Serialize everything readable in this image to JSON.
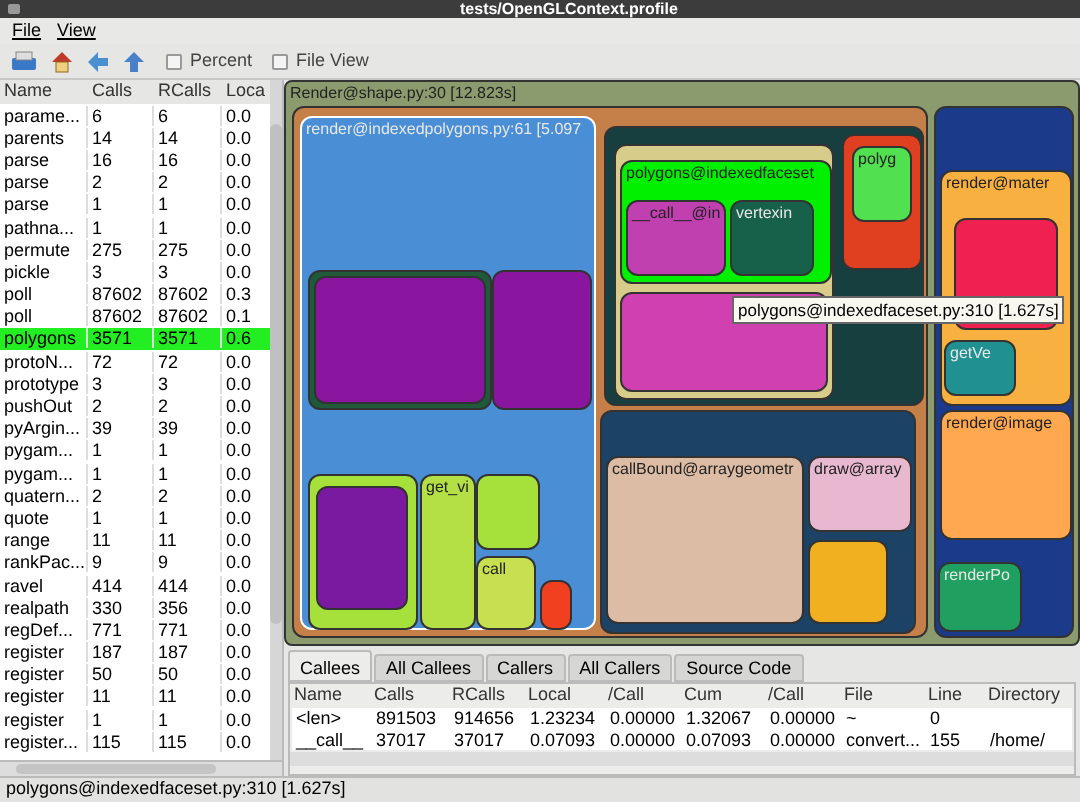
{
  "window": {
    "title": "tests/OpenGLContext.profile"
  },
  "menu": [
    "File",
    "View"
  ],
  "toolbar": {
    "checkboxes": [
      {
        "label": "Percent",
        "checked": false
      },
      {
        "label": "File View",
        "checked": false
      }
    ]
  },
  "function_list": {
    "columns": [
      "Name",
      "Calls",
      "RCalls",
      "Loca"
    ],
    "rows": [
      {
        "cells": [
          "parame...",
          "6",
          "6",
          "0.0"
        ],
        "selected": false
      },
      {
        "cells": [
          "parents",
          "14",
          "14",
          "0.0"
        ],
        "selected": false
      },
      {
        "cells": [
          "parse",
          "16",
          "16",
          "0.0"
        ],
        "selected": false
      },
      {
        "cells": [
          "parse",
          "2",
          "2",
          "0.0"
        ],
        "selected": false
      },
      {
        "cells": [
          "parse",
          "1",
          "1",
          "0.0"
        ],
        "selected": false
      },
      {
        "cells": [
          "pathna...",
          "1",
          "1",
          "0.0"
        ],
        "selected": false
      },
      {
        "cells": [
          "permute",
          "275",
          "275",
          "0.0"
        ],
        "selected": false
      },
      {
        "cells": [
          "pickle",
          "3",
          "3",
          "0.0"
        ],
        "selected": false
      },
      {
        "cells": [
          "poll",
          "87602",
          "87602",
          "0.3"
        ],
        "selected": false
      },
      {
        "cells": [
          "poll",
          "87602",
          "87602",
          "0.1"
        ],
        "selected": false
      },
      {
        "cells": [
          "polygons",
          "3571",
          "3571",
          "0.6"
        ],
        "selected": true
      },
      {
        "cells": [
          "protoN...",
          "72",
          "72",
          "0.0"
        ],
        "selected": false
      },
      {
        "cells": [
          "prototype",
          "3",
          "3",
          "0.0"
        ],
        "selected": false
      },
      {
        "cells": [
          "pushOut",
          "2",
          "2",
          "0.0"
        ],
        "selected": false
      },
      {
        "cells": [
          "pyArgin...",
          "39",
          "39",
          "0.0"
        ],
        "selected": false
      },
      {
        "cells": [
          "pygam...",
          "1",
          "1",
          "0.0"
        ],
        "selected": false
      },
      {
        "cells": [
          "pygam...",
          "1",
          "1",
          "0.0"
        ],
        "selected": false
      },
      {
        "cells": [
          "quatern...",
          "2",
          "2",
          "0.0"
        ],
        "selected": false
      },
      {
        "cells": [
          "quote",
          "1",
          "1",
          "0.0"
        ],
        "selected": false
      },
      {
        "cells": [
          "range",
          "11",
          "11",
          "0.0"
        ],
        "selected": false
      },
      {
        "cells": [
          "rankPac...",
          "9",
          "9",
          "0.0"
        ],
        "selected": false
      },
      {
        "cells": [
          "ravel",
          "414",
          "414",
          "0.0"
        ],
        "selected": false
      },
      {
        "cells": [
          "realpath",
          "330",
          "356",
          "0.0"
        ],
        "selected": false
      },
      {
        "cells": [
          "regDef...",
          "771",
          "771",
          "0.0"
        ],
        "selected": false
      },
      {
        "cells": [
          "register",
          "187",
          "187",
          "0.0"
        ],
        "selected": false
      },
      {
        "cells": [
          "register",
          "50",
          "50",
          "0.0"
        ],
        "selected": false
      },
      {
        "cells": [
          "register",
          "11",
          "11",
          "0.0"
        ],
        "selected": false
      },
      {
        "cells": [
          "register",
          "1",
          "1",
          "0.0"
        ],
        "selected": false
      },
      {
        "cells": [
          "register...",
          "115",
          "115",
          "0.0"
        ],
        "selected": false
      }
    ]
  },
  "treemap": {
    "root": {
      "label": "Render@shape.py:30 [12.823s]",
      "color": "#8b9b6e",
      "children": [
        {
          "color": "#c5804a",
          "children": [
            {
              "label": "render@indexedpolygons.py:61 [5.097",
              "color": "#4a8fd6",
              "children": [
                {
                  "color": "#1f5a3a",
                  "children": [
                    {
                      "color": "#8a16a0"
                    }
                  ]
                },
                {
                  "color": "#8a16a0"
                },
                {
                  "color": "#a6e03a",
                  "children": [
                    {
                      "color": "#7a1aa0"
                    }
                  ]
                },
                {
                  "label": "get_vi",
                  "color": "#b4e046"
                },
                {
                  "color": "#a6e03a"
                },
                {
                  "label": "call",
                  "color": "#c8e050"
                },
                {
                  "color": "#f04020"
                }
              ]
            },
            {
              "color": "#173f3f",
              "children": [
                {
                  "color": "#d8cc8a",
                  "children": [
                    {
                      "label": "polygons@indexedfaceset",
                      "color": "#00f000",
                      "children": [
                        {
                          "label": "__call__@in",
                          "color": "#c040b0"
                        },
                        {
                          "label": "vertexin",
                          "color": "#17604a"
                        }
                      ]
                    },
                    {
                      "color": "#d040b0"
                    }
                  ]
                },
                {
                  "color": "#e04020",
                  "children": [
                    {
                      "label": "polyg",
                      "color": "#50e050"
                    }
                  ]
                }
              ]
            },
            {
              "color": "#1c4266",
              "children": [
                {
                  "label": "callBound@arraygeometr",
                  "color": "#dcbca4"
                },
                {
                  "label": "draw@array",
                  "color": "#e8b8d0"
                },
                {
                  "color": "#f0b020"
                }
              ]
            }
          ]
        },
        {
          "color": "#1c3a8a",
          "children": [
            {
              "label": "render@mater",
              "color": "#f8b040",
              "children": [
                {
                  "color": "#f02050"
                },
                {
                  "label": "getVe",
                  "color": "#209090"
                }
              ]
            },
            {
              "label": "render@image",
              "color": "#ffa850"
            },
            {
              "label": "renderPo",
              "color": "#20a060"
            }
          ]
        }
      ]
    },
    "tooltip": "polygons@indexedfaceset.py:310 [1.627s]"
  },
  "detail": {
    "tabs": [
      {
        "label": "Callees",
        "selected": true
      },
      {
        "label": "All Callees",
        "selected": false
      },
      {
        "label": "Callers",
        "selected": false
      },
      {
        "label": "All Callers",
        "selected": false
      },
      {
        "label": "Source Code",
        "selected": false
      }
    ],
    "columns": [
      "Name",
      "Calls",
      "RCalls",
      "Local",
      "/Call",
      "Cum",
      "/Call",
      "File",
      "Line",
      "Directory"
    ],
    "rows": [
      [
        "<len>",
        "891503",
        "914656",
        "1.23234",
        "0.00000",
        "1.32067",
        "0.00000",
        "~",
        "0"
      ],
      [
        "__call__",
        "37017",
        "37017",
        "0.07093",
        "0.00000",
        "0.07093",
        "0.00000",
        "convert...",
        "155",
        "/home/"
      ]
    ]
  },
  "status_bar": "polygons@indexedfaceset.py:310 [1.627s]"
}
